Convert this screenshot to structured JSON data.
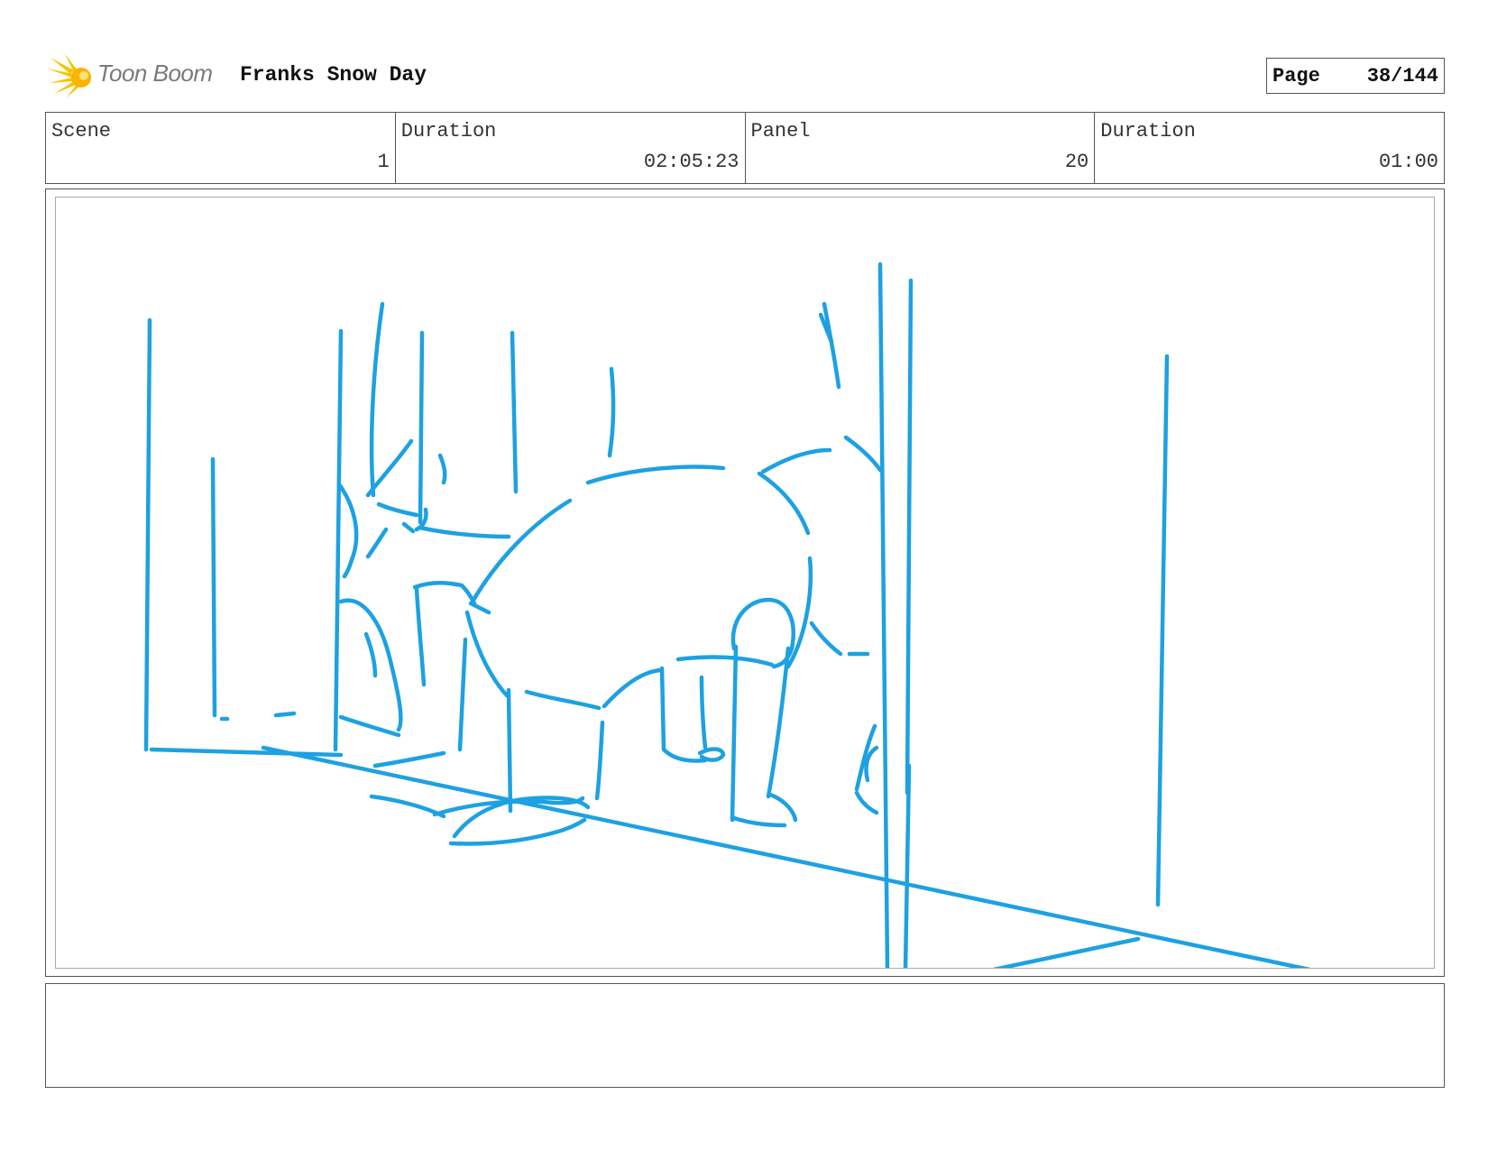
{
  "header": {
    "logo_text": "Toon Boom",
    "project_title": "Franks Snow Day",
    "page_label": "Page",
    "page_value": "38/144"
  },
  "info": {
    "scene_label": "Scene",
    "scene_value": "1",
    "scene_duration_label": "Duration",
    "scene_duration_value": "02:05:23",
    "panel_label": "Panel",
    "panel_value": "20",
    "panel_duration_label": "Duration",
    "panel_duration_value": "01:00"
  },
  "sketch": {
    "stroke_color": "#1da1e2",
    "description_icon": "rough-sketch-figure-crawling-in-room"
  },
  "notes": {
    "text": ""
  },
  "colors": {
    "logo_accent": "#f5c400",
    "logo_text": "#7a7a7a",
    "border": "#555555"
  }
}
